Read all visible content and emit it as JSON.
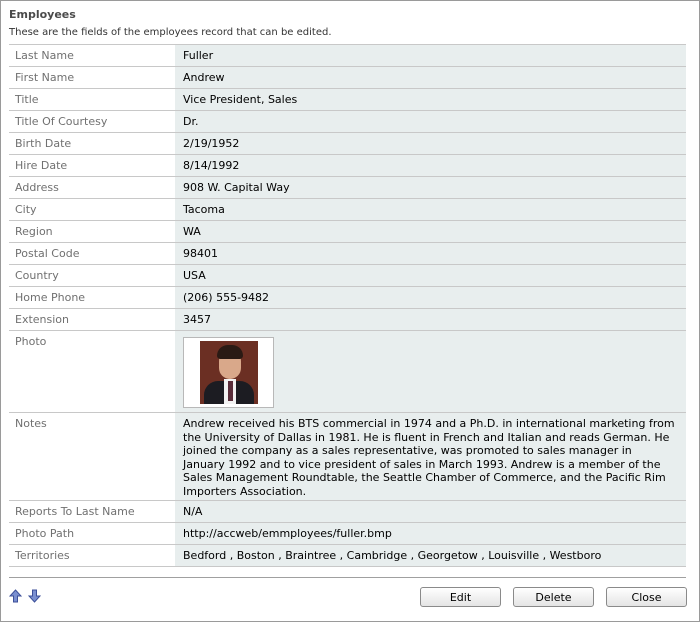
{
  "header": {
    "title": "Employees",
    "description": "These are the fields of the employees record that can be edited."
  },
  "fields": [
    {
      "label": "Last Name",
      "value": "Fuller"
    },
    {
      "label": "First Name",
      "value": "Andrew"
    },
    {
      "label": "Title",
      "value": "Vice President, Sales"
    },
    {
      "label": "Title Of Courtesy",
      "value": "Dr."
    },
    {
      "label": "Birth Date",
      "value": "2/19/1952"
    },
    {
      "label": "Hire Date",
      "value": "8/14/1992"
    },
    {
      "label": "Address",
      "value": "908 W. Capital Way"
    },
    {
      "label": "City",
      "value": "Tacoma"
    },
    {
      "label": "Region",
      "value": "WA"
    },
    {
      "label": "Postal Code",
      "value": "98401"
    },
    {
      "label": "Country",
      "value": "USA"
    },
    {
      "label": "Home Phone",
      "value": "(206) 555-9482"
    },
    {
      "label": "Extension",
      "value": "3457"
    }
  ],
  "photo": {
    "label": "Photo"
  },
  "notes": {
    "label": "Notes",
    "value": "Andrew received his BTS commercial in 1974 and a Ph.D. in international marketing from the University of Dallas in 1981. He is fluent in French and Italian and reads German. He joined the company as a sales representative, was promoted to sales manager in January 1992 and to vice president of sales in March 1993. Andrew is a member of the Sales Management Roundtable, the Seattle Chamber of Commerce, and the Pacific Rim Importers Association."
  },
  "fields_after": [
    {
      "label": "Reports To Last Name",
      "value": "N/A"
    },
    {
      "label": "Photo Path",
      "value": "http://accweb/emmployees/fuller.bmp"
    },
    {
      "label": "Territories",
      "value": "Bedford , Boston , Braintree , Cambridge , Georgetow , Louisville , Westboro"
    }
  ],
  "nav": {
    "up_icon": "arrow-up-icon",
    "down_icon": "arrow-down-icon",
    "color": "#5a6fb8"
  },
  "buttons": {
    "edit": "Edit",
    "delete": "Delete",
    "close": "Close"
  }
}
